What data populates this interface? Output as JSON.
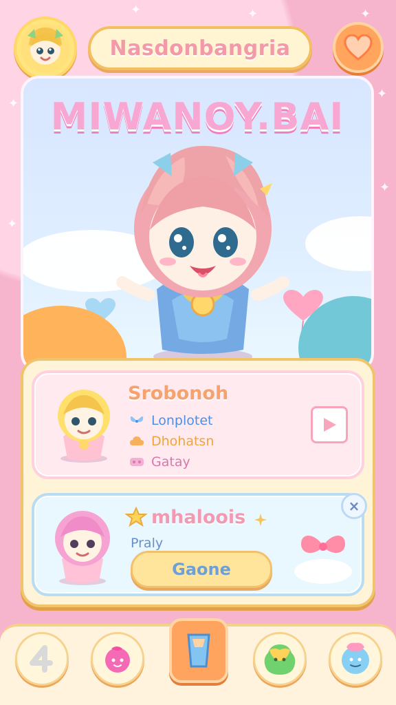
{
  "header": {
    "title": "Nasdonbangria"
  },
  "scene": {
    "title": "MIWANOY.BAI"
  },
  "character_card": {
    "title": "Srobonoh",
    "stats": [
      {
        "label": "Lonplotet",
        "icon": "butterfly-icon",
        "color": "#4c8fe8"
      },
      {
        "label": "Dhohatsn",
        "icon": "cloud-icon",
        "color": "#f0a43a"
      },
      {
        "label": "Gatay",
        "icon": "badge-icon",
        "color": "#d679ad"
      }
    ]
  },
  "quest_card": {
    "title": "mhaloois",
    "subtitle": "Praly",
    "button_label": "Gaone"
  },
  "nav": {
    "items": [
      {
        "icon": "number-four-icon"
      },
      {
        "icon": "pink-friend-icon"
      },
      {
        "icon": "cup-icon"
      },
      {
        "icon": "green-pet-icon"
      },
      {
        "icon": "blue-pet-icon"
      }
    ]
  },
  "colors": {
    "pink": "#f6b5cc",
    "yellow": "#ffe59b",
    "orange": "#ffa55e",
    "blue": "#b9dcf5"
  }
}
